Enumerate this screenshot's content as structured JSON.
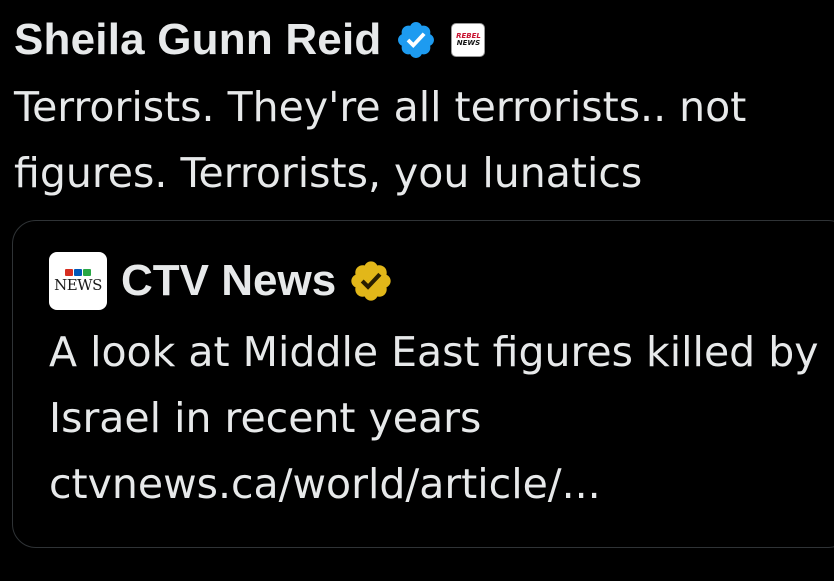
{
  "tweet": {
    "author_name": "Sheila Gunn Reid",
    "verified_icon": "verified-badge-blue",
    "affiliation_icon": "rebel-news-logo",
    "affiliation_logo_text": [
      "REBEL",
      "NEWS"
    ],
    "text": "Terrorists. They're all terrorists.. not figures. Terrorists, you lunatics"
  },
  "quoted_tweet": {
    "author_name": "CTV News",
    "avatar_icon": "ctv-news-logo",
    "avatar_text": "NEWS",
    "verified_icon": "verified-badge-gold",
    "text": "A look at Middle East figures killed by Israel in recent years",
    "link": "ctvnews.ca/world/article/..."
  },
  "colors": {
    "background": "#000000",
    "text": "#e7e9ea",
    "border": "#2f3336",
    "blue_badge": "#1d9bf0",
    "gold_badge": "#e2b719"
  }
}
